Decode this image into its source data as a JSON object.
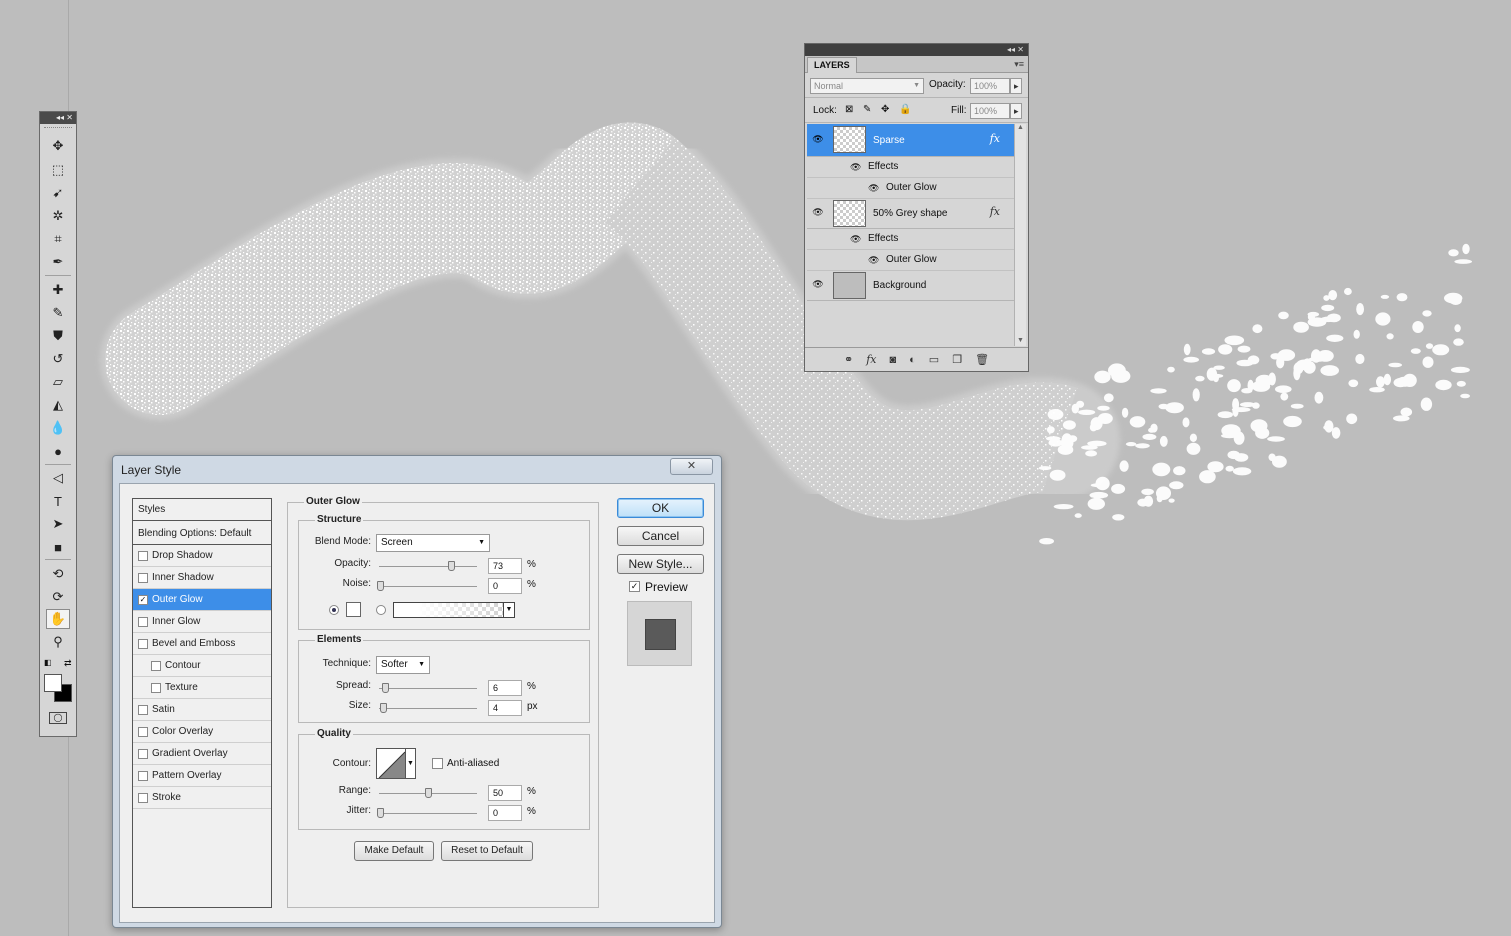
{
  "layers_panel": {
    "tab": "LAYERS",
    "collapse_glyph": "◂◂ ✕",
    "menu_glyph": "▾≡",
    "blend_mode": "Normal",
    "opacity_label": "Opacity:",
    "opacity_value": "100%",
    "lock_label": "Lock:",
    "fill_label": "Fill:",
    "fill_value": "100%",
    "layers": [
      {
        "name": "Sparse",
        "fx": "fx",
        "effects_label": "Effects",
        "effect": "Outer Glow"
      },
      {
        "name": "50% Grey shape",
        "fx": "fx",
        "effects_label": "Effects",
        "effect": "Outer Glow"
      },
      {
        "name": "Background"
      }
    ]
  },
  "toolbox": {
    "collapse_glyph": "◂◂ ✕"
  },
  "dialog": {
    "title": "Layer Style",
    "close_glyph": "✕",
    "styles_header": "Styles",
    "blending_options": "Blending Options: Default",
    "style_items": [
      {
        "label": "Drop Shadow",
        "checked": ""
      },
      {
        "label": "Inner Shadow",
        "checked": ""
      },
      {
        "label": "Outer Glow",
        "checked": "✓"
      },
      {
        "label": "Inner Glow",
        "checked": ""
      },
      {
        "label": "Bevel and Emboss",
        "checked": ""
      },
      {
        "label": "Contour",
        "checked": ""
      },
      {
        "label": "Texture",
        "checked": ""
      },
      {
        "label": "Satin",
        "checked": ""
      },
      {
        "label": "Color Overlay",
        "checked": ""
      },
      {
        "label": "Gradient Overlay",
        "checked": ""
      },
      {
        "label": "Pattern Overlay",
        "checked": ""
      },
      {
        "label": "Stroke",
        "checked": ""
      }
    ],
    "section_title": "Outer Glow",
    "structure": {
      "title": "Structure",
      "blend_mode_label": "Blend Mode:",
      "blend_mode": "Screen",
      "opacity_label": "Opacity:",
      "opacity": "73",
      "noise_label": "Noise:",
      "noise": "0",
      "percent": "%"
    },
    "elements": {
      "title": "Elements",
      "technique_label": "Technique:",
      "technique": "Softer",
      "spread_label": "Spread:",
      "spread": "6",
      "size_label": "Size:",
      "size": "4",
      "percent": "%",
      "px": "px"
    },
    "quality": {
      "title": "Quality",
      "contour_label": "Contour:",
      "anti_aliased": "Anti-aliased",
      "range_label": "Range:",
      "range": "50",
      "jitter_label": "Jitter:",
      "jitter": "0",
      "percent": "%"
    },
    "make_default": "Make Default",
    "reset_default": "Reset to Default",
    "ok": "OK",
    "cancel": "Cancel",
    "new_style": "New Style...",
    "preview_label": "Preview",
    "preview_checked": "✓"
  }
}
